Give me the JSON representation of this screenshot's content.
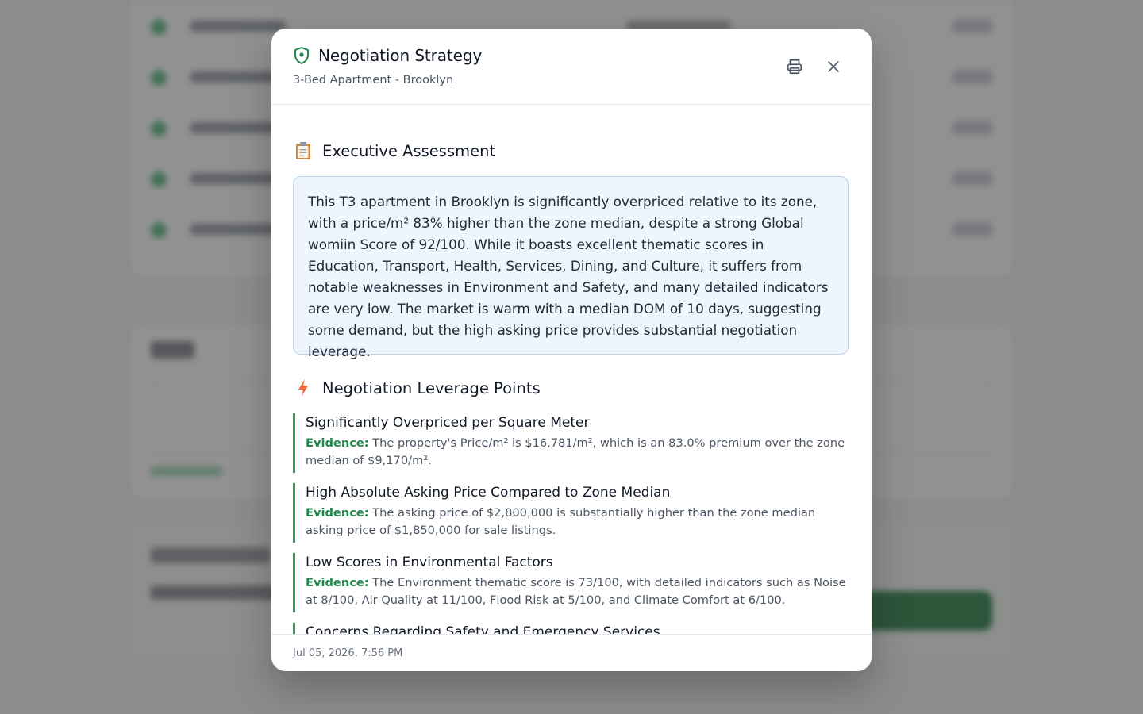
{
  "modal": {
    "title": "Negotiation Strategy",
    "subtitle": "3-Bed Apartment - Brooklyn",
    "print_icon": "printer-icon",
    "close_icon": "close-icon"
  },
  "assessment": {
    "heading": "Executive Assessment",
    "icon": "clipboard-icon",
    "text": "This T3 apartment in Brooklyn is significantly overpriced relative to its zone, with a price/m² 83% higher than the zone median, despite a strong Global womiin Score of 92/100. While it boasts excellent thematic scores in Education, Transport, Health, Services, Dining, and Culture, it suffers from notable weaknesses in Environment and Safety, and many detailed indicators are very low. The market is warm with a median DOM of 10 days, suggesting some demand, but the high asking price provides substantial negotiation leverage."
  },
  "leverage": {
    "heading": "Negotiation Leverage Points",
    "icon": "lightning-icon",
    "evidence_label": "Evidence:",
    "points": [
      {
        "title": "Significantly Overpriced per Square Meter",
        "evidence": "The property's Price/m² is $16,781/m², which is an 83.0% premium over the zone median of $9,170/m²."
      },
      {
        "title": "High Absolute Asking Price Compared to Zone Median",
        "evidence": "The asking price of $2,800,000 is substantially higher than the zone median asking price of $1,850,000 for sale listings."
      },
      {
        "title": "Low Scores in Environmental Factors",
        "evidence": "The Environment thematic score is 73/100, with detailed indicators such as Noise at 8/100, Air Quality at 11/100, Flood Risk at 5/100, and Climate Comfort at 6/100."
      },
      {
        "title": "Concerns Regarding Safety and Emergency Services",
        "evidence": ""
      }
    ]
  },
  "footer": {
    "timestamp": "Jul 05, 2026, 7:56 PM"
  },
  "colors": {
    "accent_green": "#1f8a4c",
    "assessment_bg": "#eef5fd",
    "assessment_border": "#b9d3ef"
  }
}
